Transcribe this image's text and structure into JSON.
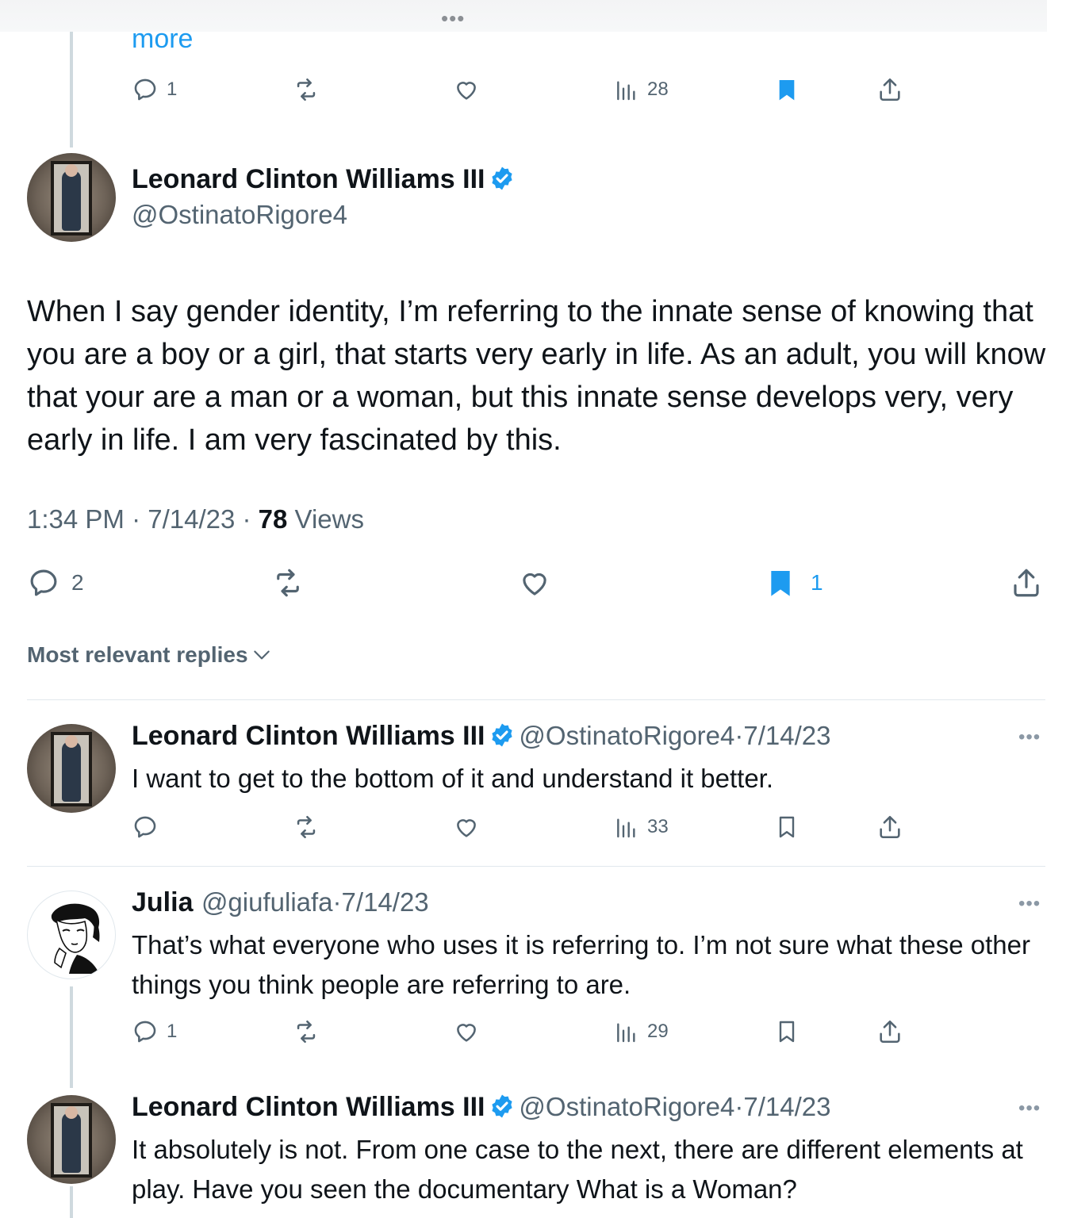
{
  "top_fragment": {
    "more_link": "more",
    "actions": {
      "replies": "1",
      "views": "28"
    }
  },
  "main_tweet": {
    "author_name": "Leonard Clinton Williams III",
    "author_handle": "@OstinatoRigore4",
    "text": "When I say gender identity, I’m referring to the innate sense of knowing that you are a boy or a girl, that starts very early in life. As an adult, you will know that your are a man or a woman, but this innate sense develops very, very early in life. I am very fascinated by this.",
    "time": "1:34 PM · 7/14/23 · ",
    "views_count": "78",
    "views_label": " Views",
    "actions": {
      "replies": "2",
      "bookmarks": "1"
    }
  },
  "sort": {
    "label": "Most relevant replies"
  },
  "replies": [
    {
      "author_name": "Leonard Clinton Williams III",
      "author_handle": "@OstinatoRigore4",
      "date": "7/14/23",
      "text": "I want to get to the bottom of it and understand it better.",
      "views": "33"
    },
    {
      "author_name": "Julia",
      "author_handle": "@giufuliafa",
      "date": "7/14/23",
      "text": "That’s what everyone who uses it is referring to. I’m not sure what these other things you think people are referring to are.",
      "replies": "1",
      "views": "29"
    },
    {
      "author_name": "Leonard Clinton Williams III",
      "author_handle": "@OstinatoRigore4",
      "date": "7/14/23",
      "text": "It absolutely is not. From one case to the next, there are different elements at play. Have you seen the documentary What is a Woman?"
    }
  ],
  "colors": {
    "accent": "#1d9bf0",
    "secondary_text": "#536471",
    "primary_text": "#0f1419",
    "divider": "#e1e8ed"
  },
  "icons": [
    "reply-icon",
    "retweet-icon",
    "like-icon",
    "views-icon",
    "bookmark-icon",
    "share-icon",
    "verified-badge-icon",
    "chevron-down-icon",
    "more-icon"
  ]
}
